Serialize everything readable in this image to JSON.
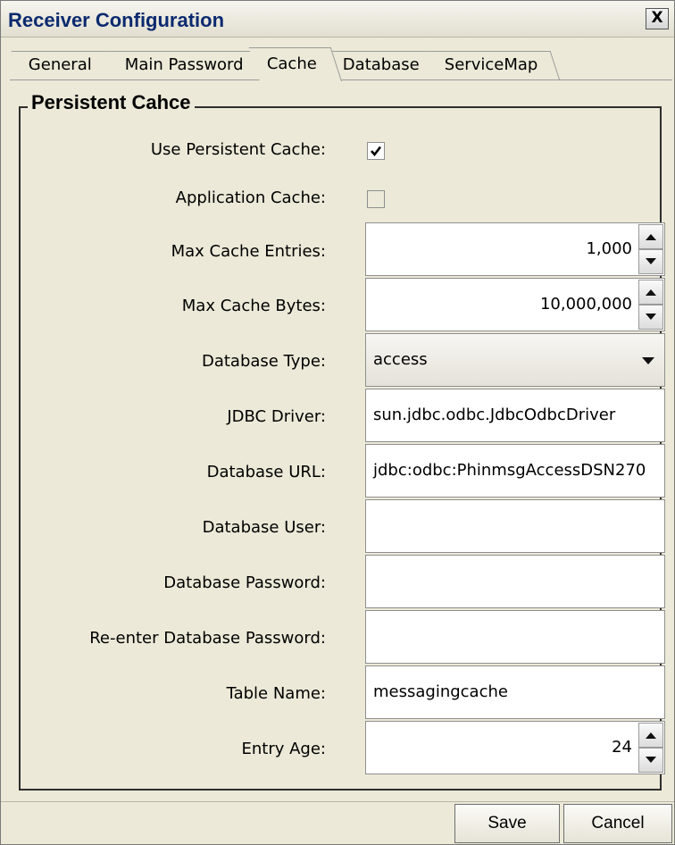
{
  "window": {
    "title": "Receiver Configuration",
    "close_label": "X"
  },
  "tabs": [
    {
      "label": "General"
    },
    {
      "label": "Main Password"
    },
    {
      "label": "Cache"
    },
    {
      "label": "Database"
    },
    {
      "label": "ServiceMap"
    }
  ],
  "active_tab": "Cache",
  "group": {
    "legend": "Persistent Cahce"
  },
  "form": {
    "use_persistent_cache": {
      "label": "Use Persistent Cache:",
      "checked": true
    },
    "application_cache": {
      "label": "Application Cache:",
      "checked": false
    },
    "max_cache_entries": {
      "label": "Max Cache Entries:",
      "value": "1,000"
    },
    "max_cache_bytes": {
      "label": "Max Cache Bytes:",
      "value": "10,000,000"
    },
    "database_type": {
      "label": "Database Type:",
      "value": "access"
    },
    "jdbc_driver": {
      "label": "JDBC Driver:",
      "value": "sun.jdbc.odbc.JdbcOdbcDriver"
    },
    "database_url": {
      "label": "Database URL:",
      "value": "jdbc:odbc:PhinmsgAccessDSN270"
    },
    "database_user": {
      "label": "Database User:",
      "value": ""
    },
    "database_password": {
      "label": "Database Password:",
      "value": ""
    },
    "reenter_password": {
      "label": "Re-enter Database Password:",
      "value": ""
    },
    "table_name": {
      "label": "Table Name:",
      "value": "messagingcache"
    },
    "entry_age": {
      "label": "Entry Age:",
      "value": "24"
    }
  },
  "buttons": {
    "save": "Save",
    "cancel": "Cancel"
  },
  "colors": {
    "title_text": "#0b2a6f",
    "window_bg": "#ece9d8"
  }
}
